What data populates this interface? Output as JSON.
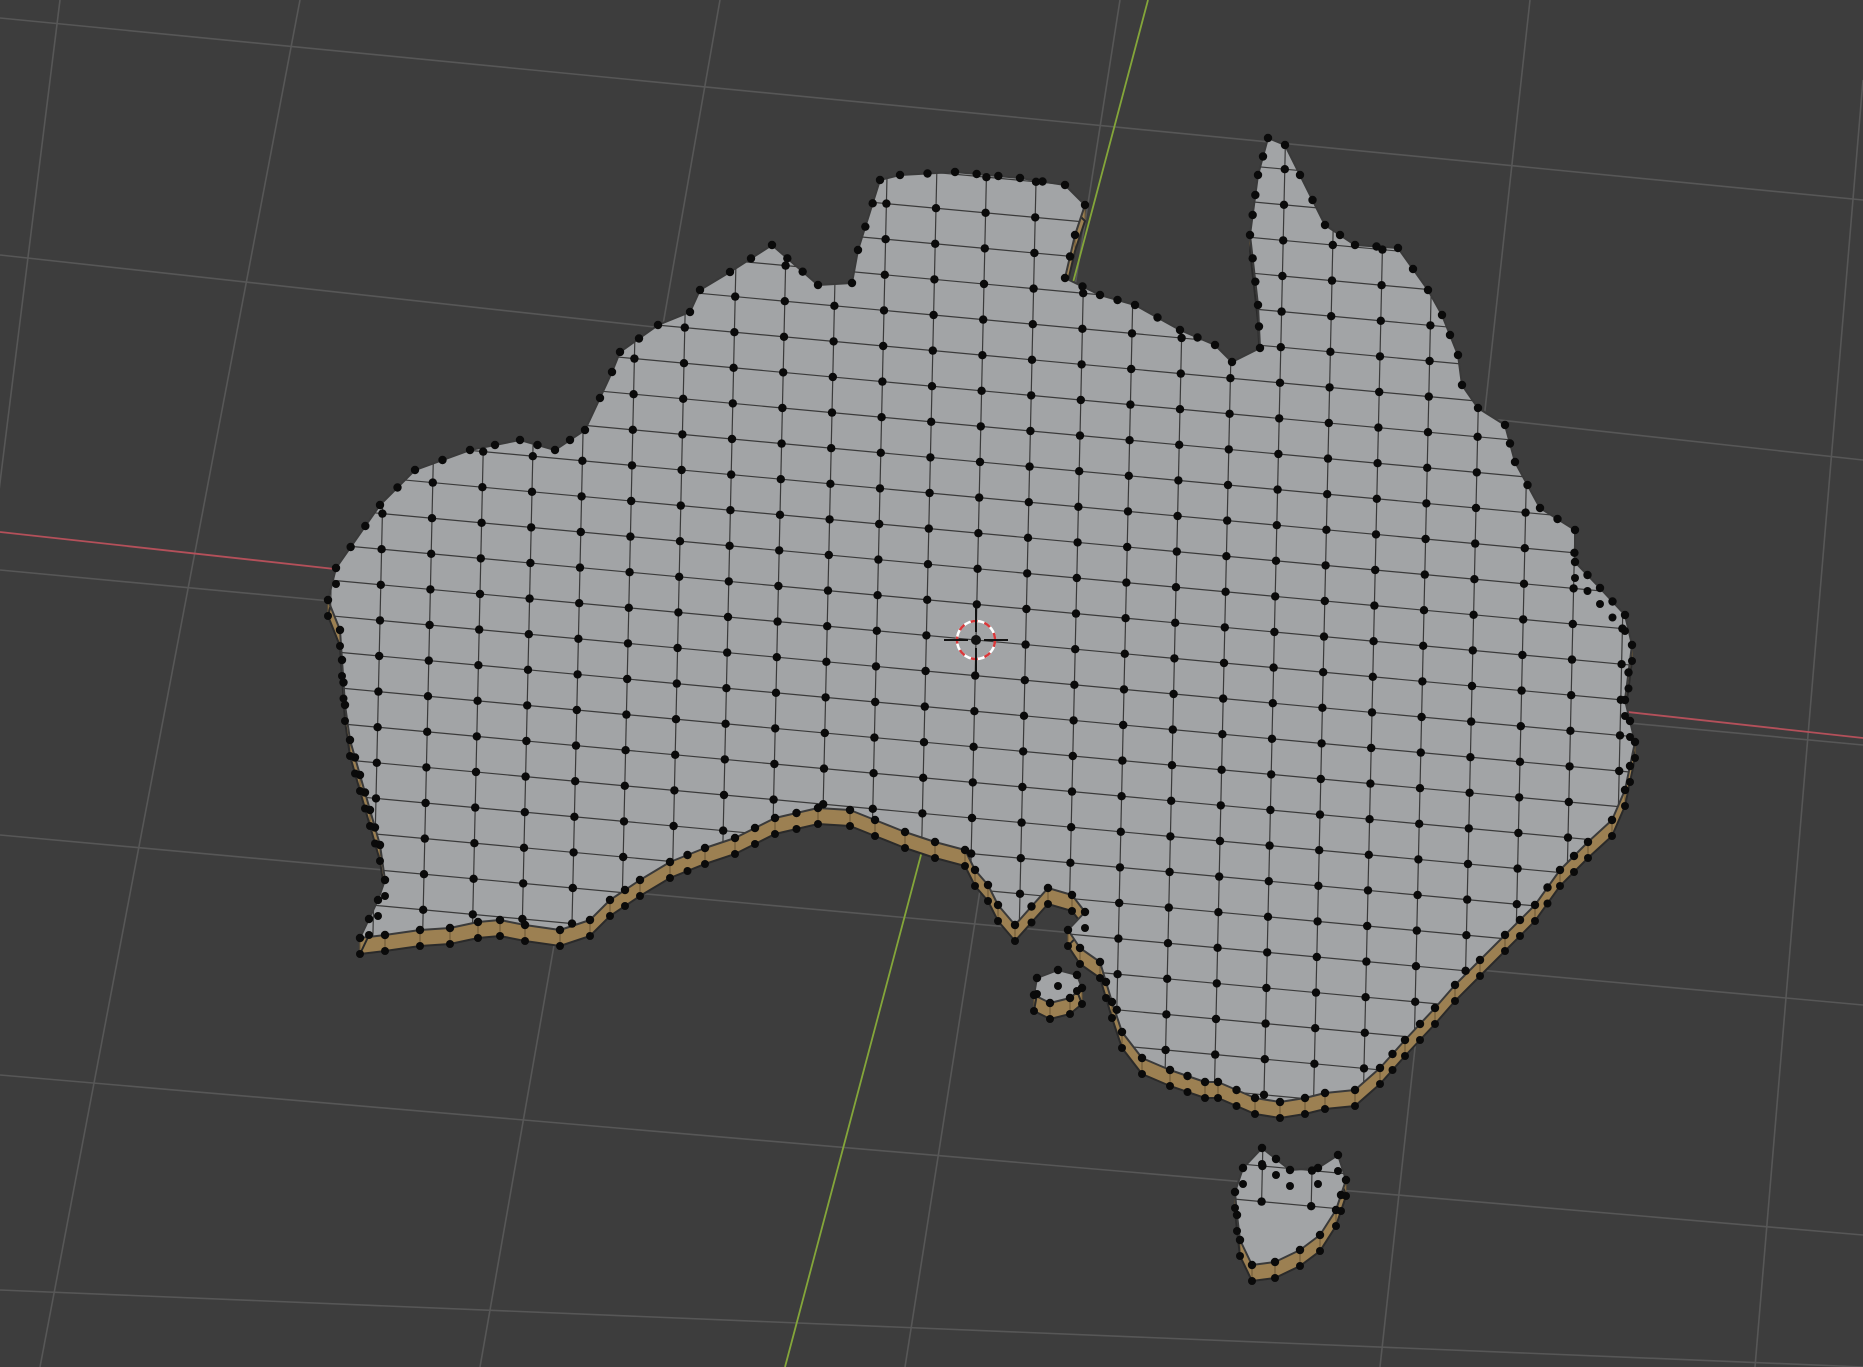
{
  "app": {
    "name": "3D Viewport",
    "mode": "edit-mode"
  },
  "scene": {
    "object_name": "australia-mesh",
    "colors": {
      "background": "#3d3d3d",
      "grid": "#575757",
      "x_axis": "#b4505a",
      "y_axis": "#84a63a",
      "face": "#a2a4a6",
      "side": "#9c8052",
      "edge": "#3a3a3a",
      "vertex": "#0a0a0a",
      "cursor_red": "#d8383a",
      "cursor_white": "#ffffff"
    },
    "icons": {
      "cursor": "3d-cursor-icon",
      "origin": "object-origin-icon"
    }
  }
}
